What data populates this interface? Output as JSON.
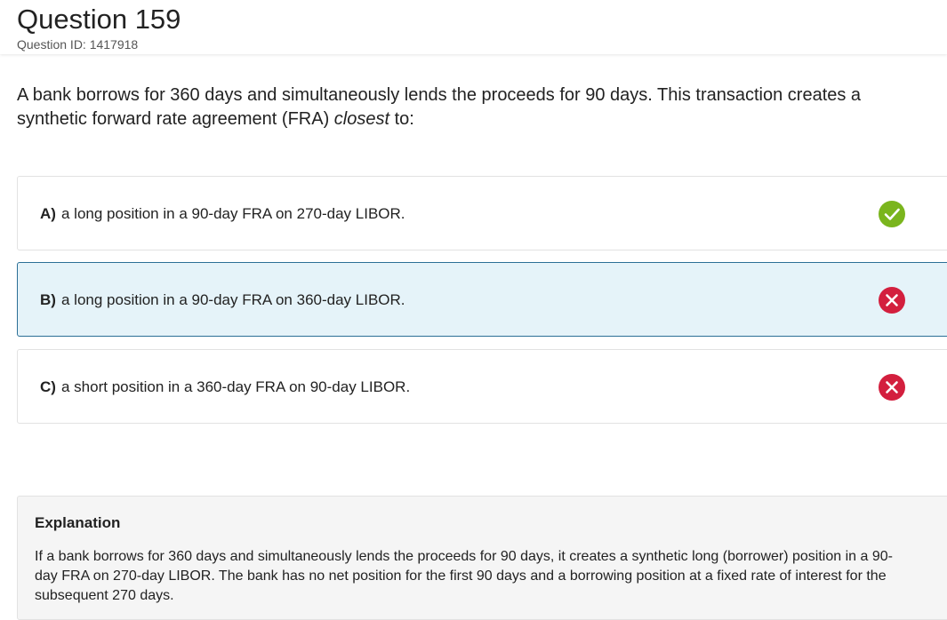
{
  "question": {
    "title": "Question 159",
    "id_label": "Question ID: 1417918",
    "stem_before": "A bank borrows for 360 days and simultaneously lends the proceeds for 90 days. This transaction creates a synthetic forward rate agreement (FRA) ",
    "stem_emphasis": "closest",
    "stem_after": " to:"
  },
  "choices": [
    {
      "letter": "A)",
      "text": "a long position in a 90-day FRA on 270-day LIBOR.",
      "status": "correct-icon",
      "selected": false
    },
    {
      "letter": "B)",
      "text": "a long position in a 90-day FRA on 360-day LIBOR.",
      "status": "incorrect-icon",
      "selected": true
    },
    {
      "letter": "C)",
      "text": "a short position in a 360-day FRA on 90-day LIBOR.",
      "status": "incorrect-icon",
      "selected": false
    }
  ],
  "explanation": {
    "title": "Explanation",
    "body": "If a bank borrows for 360 days and simultaneously lends the proceeds for 90 days, it creates a synthetic long (borrower) position in a 90-day FRA on 270-day LIBOR. The bank has no net position for the first 90 days and a borrowing position at a fixed rate of interest for the subsequent 270 days."
  },
  "colors": {
    "correct": "#7ab51d",
    "incorrect": "#d31f3e",
    "selected_background": "#e5f3f9",
    "selected_border": "#2b6f96"
  }
}
